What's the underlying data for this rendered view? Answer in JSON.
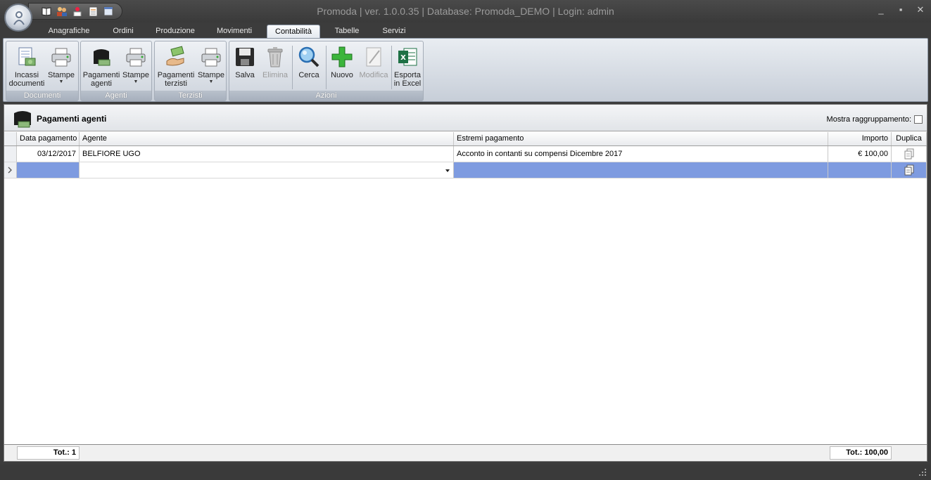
{
  "window": {
    "title": "Promoda | ver. 1.0.0.35 | Database: Promoda_DEMO | Login: admin"
  },
  "tabs": [
    {
      "label": "Anagrafiche",
      "active": false
    },
    {
      "label": "Ordini",
      "active": false
    },
    {
      "label": "Produzione",
      "active": false
    },
    {
      "label": "Movimenti",
      "active": false
    },
    {
      "label": "Contabilità",
      "active": true
    },
    {
      "label": "Tabelle",
      "active": false
    },
    {
      "label": "Servizi",
      "active": false
    }
  ],
  "ribbon": {
    "groups": {
      "documenti": {
        "label": "Documenti"
      },
      "agenti": {
        "label": "Agenti"
      },
      "terzisti": {
        "label": "Terzisti"
      },
      "azioni": {
        "label": "Azioni"
      }
    },
    "buttons": {
      "incassi_documenti": {
        "line1": "Incassi",
        "line2": "documenti"
      },
      "stampe_documenti": {
        "line1": "Stampe"
      },
      "pagamenti_agenti": {
        "line1": "Pagamenti",
        "line2": "agenti"
      },
      "stampe_agenti": {
        "line1": "Stampe"
      },
      "pagamenti_terzisti": {
        "line1": "Pagamenti",
        "line2": "terzisti"
      },
      "stampe_terzisti": {
        "line1": "Stampe"
      },
      "salva": {
        "line1": "Salva"
      },
      "elimina": {
        "line1": "Elimina",
        "disabled": true
      },
      "cerca": {
        "line1": "Cerca"
      },
      "nuovo": {
        "line1": "Nuovo"
      },
      "modifica": {
        "line1": "Modifica",
        "disabled": true
      },
      "esporta": {
        "line1": "Esporta",
        "line2": "in Excel"
      }
    }
  },
  "panel": {
    "title": "Pagamenti agenti",
    "group_toggle_label": "Mostra raggruppamento:",
    "group_toggle_checked": false
  },
  "grid": {
    "columns": {
      "data_pagamento": "Data pagamento",
      "agente": "Agente",
      "estremi": "Estremi pagamento",
      "importo": "Importo",
      "duplica": "Duplica"
    },
    "rows": [
      {
        "data_pagamento": "03/12/2017",
        "agente": "BELFIORE UGO",
        "estremi": "Acconto in contanti su compensi Dicembre 2017",
        "importo": "€ 100,00"
      }
    ]
  },
  "footer": {
    "count_total": "Tot.: 1",
    "amount_total": "Tot.: 100,00"
  },
  "colors": {
    "selection": "#7e9be0",
    "chrome_dark": "#3c3c3c"
  }
}
